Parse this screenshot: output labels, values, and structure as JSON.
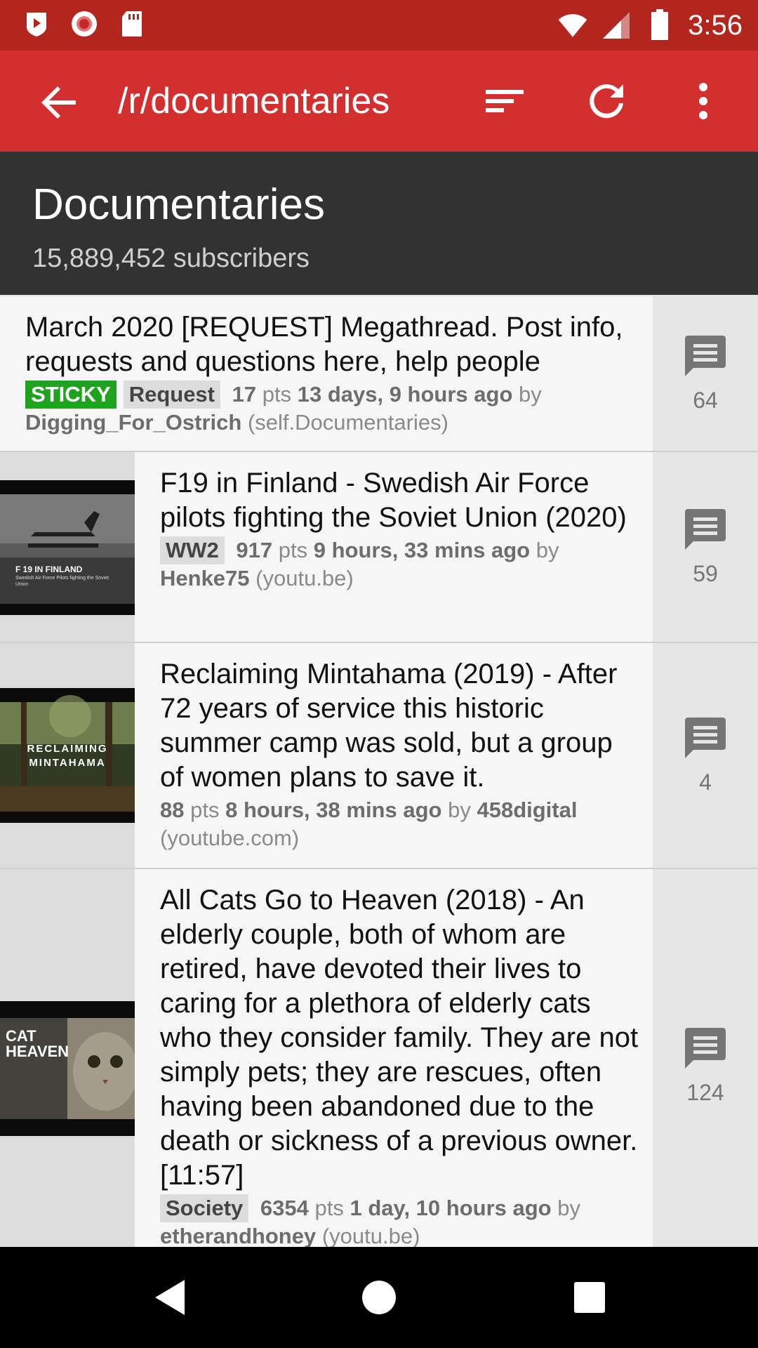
{
  "status_bar": {
    "time": "3:56",
    "icons": [
      "play-badge-icon",
      "record-icon",
      "sd-card-icon",
      "wifi-icon",
      "signal-icon",
      "battery-icon"
    ]
  },
  "app_bar": {
    "title": "/r/documentaries",
    "icons": [
      "back-arrow-icon",
      "sort-icon",
      "refresh-icon",
      "overflow-menu-icon"
    ]
  },
  "subreddit": {
    "name": "Documentaries",
    "subscribers": "15,889,452 subscribers"
  },
  "posts": [
    {
      "title": "March 2020 [REQUEST] Megathread. Post info, requests and questions here, help people",
      "sticky": "STICKY",
      "flair": "Request",
      "points": "17",
      "pts_label": "pts",
      "time": "13 days, 9 hours ago",
      "by": "by",
      "author": "Digging_For_Ostrich",
      "domain": "(self.Documentaries)",
      "comments": "64"
    },
    {
      "title": "F19 in Finland - Swedish Air Force pilots fighting the Soviet Union (2020)",
      "flair": "WW2",
      "points": "917",
      "pts_label": "pts",
      "time": "9 hours, 33 mins ago",
      "by": "by",
      "author": "Henke75",
      "domain": "(youtu.be)",
      "comments": "59",
      "thumb_text_1": "F 19 IN FINLAND",
      "thumb_text_2": "Swedish Air Force Pilots fighting the Soviet Union"
    },
    {
      "title": "Reclaiming Mintahama (2019) - After 72 years of service this historic summer camp was sold, but a group of women plans to save it.",
      "points": "88",
      "pts_label": "pts",
      "time": "8 hours, 38 mins ago",
      "by": "by",
      "author": "458digital",
      "domain": "(youtube.com)",
      "comments": "4",
      "thumb_text_1": "RECLAIMING",
      "thumb_text_2": "MINTAHAMA"
    },
    {
      "title": "All Cats Go to Heaven (2018) - An elderly couple, both of whom are retired, have devoted their lives to caring for a plethora of elderly cats who they consider family. They are not simply pets; they are rescues, often having been abandoned due to the death or sickness of a previous owner. [11:57]",
      "flair": "Society",
      "points": "6354",
      "pts_label": "pts",
      "time": "1 day, 10 hours ago",
      "by": "by",
      "author": "etherandhoney",
      "domain": "(youtu.be)",
      "comments": "124",
      "thumb_text_1": "CAT",
      "thumb_text_2": "HEAVEN"
    }
  ],
  "nav_bar": {
    "icons": [
      "nav-back-icon",
      "nav-home-icon",
      "nav-recents-icon"
    ]
  },
  "colors": {
    "status_bar": "#b3261e",
    "app_bar": "#d32f2f",
    "header": "#323232",
    "sticky": "#1fa31f"
  }
}
